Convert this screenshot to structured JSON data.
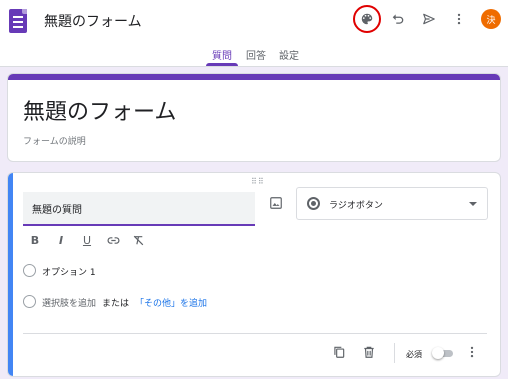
{
  "header": {
    "doc_title": "無題のフォーム",
    "avatar_initial": "決",
    "icons": [
      "forms-app-icon",
      "palette-icon",
      "undo-icon",
      "send-icon",
      "more-vert-icon"
    ]
  },
  "tabs": [
    {
      "label": "質問",
      "active": true
    },
    {
      "label": "回答",
      "active": false
    },
    {
      "label": "設定",
      "active": false
    }
  ],
  "form": {
    "title": "無題のフォーム",
    "description_placeholder": "フォームの説明"
  },
  "question": {
    "title_placeholder": "無題の質問",
    "type_label": "ラジオボタン",
    "format_buttons": [
      "B",
      "I",
      "U",
      "link",
      "clear-format"
    ],
    "options": [
      {
        "label": "オプション 1"
      }
    ],
    "add_option": {
      "add_label": "選択肢を追加",
      "or_label": "または",
      "add_other_label": "「その他」を追加"
    },
    "required_label": "必須",
    "required": false
  },
  "colors": {
    "accent": "#673ab7",
    "background": "#f0ebf8",
    "active_card": "#4285f4",
    "avatar": "#ef6c00",
    "highlight_circle": "#e00000",
    "link": "#1a73e8"
  }
}
